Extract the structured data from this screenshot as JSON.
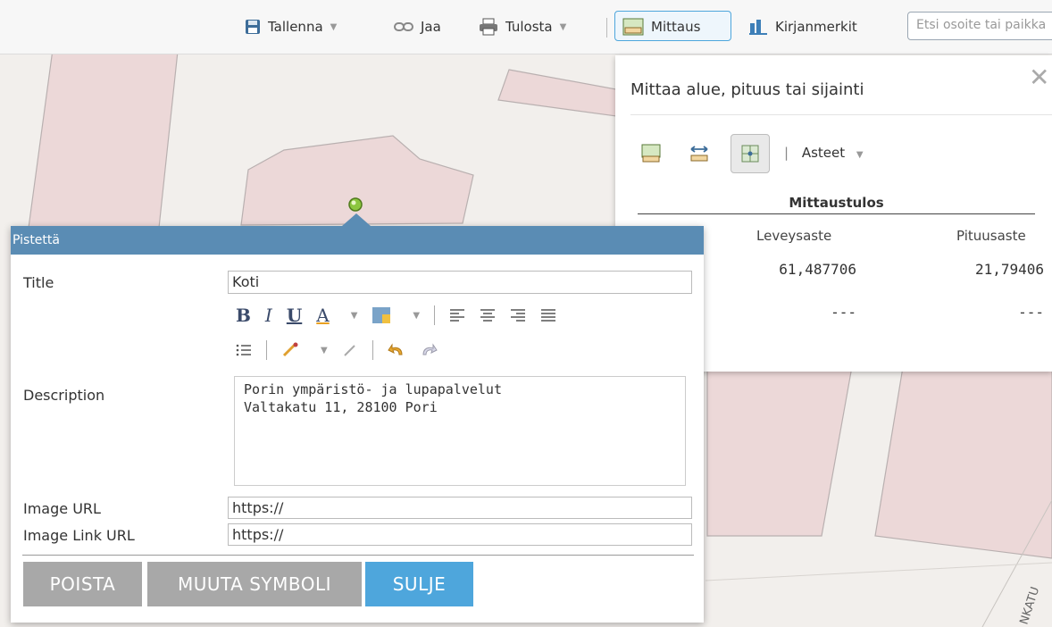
{
  "toolbar": {
    "save_label": "Tallenna",
    "share_label": "Jaa",
    "print_label": "Tulosta",
    "measure_label": "Mittaus",
    "bookmarks_label": "Kirjanmerkit",
    "search_placeholder": "Etsi osoite tai paikka"
  },
  "measure_panel": {
    "title": "Mittaa alue, pituus tai sijainti",
    "close_glyph": "✕",
    "unit_label": "Asteet",
    "unit_separator": "|",
    "result_header": "Mittaustulos",
    "columns": [
      "Leveysaste",
      "Pituusaste"
    ],
    "rows": [
      {
        "lat": "61,487706",
        "lon": "21,79406"
      },
      {
        "lat": "---",
        "lon": "---"
      }
    ]
  },
  "popup": {
    "header_title": "Pistettä",
    "title_label": "Title",
    "title_value": "Koti",
    "description_label": "Description",
    "description_text": "Porin ympäristö- ja lupapalvelut\nValtakatu 11, 28100 Pori",
    "image_url_label": "Image URL",
    "image_url_value": "https://",
    "image_link_label": "Image Link URL",
    "image_link_value": "https://",
    "buttons": {
      "delete": "POISTA",
      "change_symbol": "MUUTA SYMBOLI",
      "close": "SULJE"
    },
    "rte": {
      "bold": "B",
      "italic": "I",
      "underline": "U",
      "font_color": "A"
    }
  },
  "map": {
    "street_label": "NKATU"
  },
  "colors": {
    "accent": "#4ea6dc",
    "popup_header": "#5a8cb4",
    "button_gray": "#a8a8a8",
    "button_blue": "#4ea6dc",
    "building_fill": "#ecd8d8",
    "map_bg": "#f2efec"
  }
}
